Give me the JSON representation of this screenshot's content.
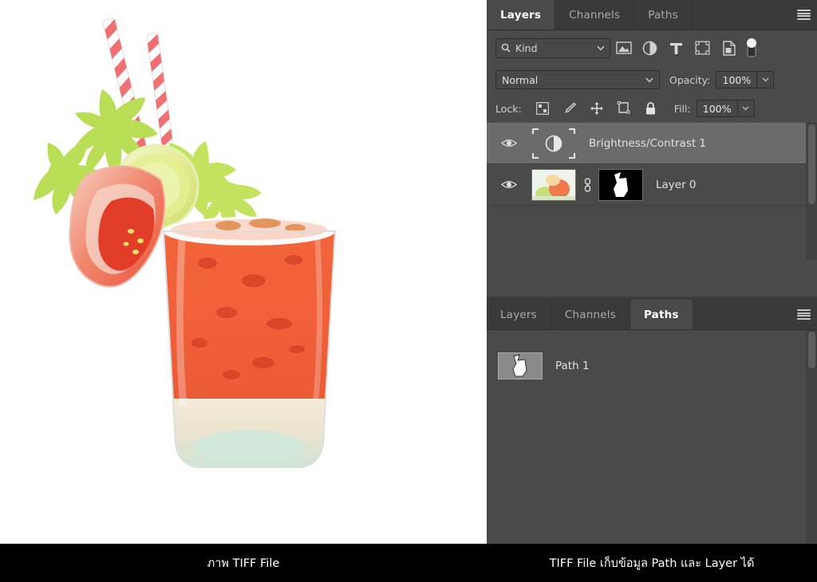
{
  "app": {
    "accent_selected": "#6b6b6b",
    "panel_bg": "#4a4a4a",
    "tabbar_bg": "#3a3a3a"
  },
  "canvas": {
    "description": "Bloody Mary cocktail in a rocks glass with celery leaves, tomato wedge, lime slice and two red-and-white striped straws on a white background",
    "background": "#ffffff"
  },
  "layers_panel": {
    "tabs": [
      {
        "label": "Layers",
        "active": true
      },
      {
        "label": "Channels",
        "active": false
      },
      {
        "label": "Paths",
        "active": false
      }
    ],
    "menu_icon": "hamburger-menu-icon",
    "filter": {
      "search_icon": "search-icon",
      "kind_label": "Kind",
      "dropdown_icon": "chevron-down-icon",
      "type_filters": [
        {
          "name": "filter-pixel-layers",
          "icon": "image-icon"
        },
        {
          "name": "filter-adjustment-layers",
          "icon": "adjustment-half-circle-icon"
        },
        {
          "name": "filter-type-layers",
          "icon": "text-t-icon"
        },
        {
          "name": "filter-shape-layers",
          "icon": "shape-icon"
        },
        {
          "name": "filter-smart-objects",
          "icon": "smart-object-icon"
        }
      ],
      "toggle_icon": "filter-toggle-switch"
    },
    "blend": {
      "mode": "Normal",
      "dropdown_icon": "chevron-down-icon",
      "opacity_label": "Opacity:",
      "opacity_value": "100%",
      "opacity_stepper_icon": "chevron-down-icon"
    },
    "lock": {
      "label": "Lock:",
      "buttons": [
        {
          "name": "lock-transparent-pixels",
          "icon": "checkerboard-icon"
        },
        {
          "name": "lock-image-pixels",
          "icon": "brush-icon"
        },
        {
          "name": "lock-position",
          "icon": "move-arrows-icon"
        },
        {
          "name": "lock-artboard-nesting",
          "icon": "artboard-icon"
        },
        {
          "name": "lock-all",
          "icon": "padlock-icon"
        }
      ],
      "fill_label": "Fill:",
      "fill_value": "100%",
      "fill_stepper_icon": "chevron-down-icon"
    },
    "layers": [
      {
        "name": "Brightness/Contrast 1",
        "visible": true,
        "selected": true,
        "thumb_type": "adjustment",
        "thumb_icon": "brightness-contrast-icon",
        "eye_icon": "eye-icon"
      },
      {
        "name": "Layer 0",
        "visible": true,
        "selected": false,
        "thumb_type": "image",
        "has_mask": true,
        "link_icon": "link-chain-icon",
        "eye_icon": "eye-icon"
      }
    ]
  },
  "paths_panel": {
    "tabs": [
      {
        "label": "Layers",
        "active": false
      },
      {
        "label": "Channels",
        "active": false
      },
      {
        "label": "Paths",
        "active": true
      }
    ],
    "menu_icon": "hamburger-menu-icon",
    "paths": [
      {
        "name": "Path 1",
        "selected": true,
        "thumb_icon": "path-shape-thumbnail"
      }
    ]
  },
  "captions": {
    "left": "ภาพ TIFF File",
    "right": "TIFF File เก็บข้อมูล Path และ Layer ได้"
  }
}
